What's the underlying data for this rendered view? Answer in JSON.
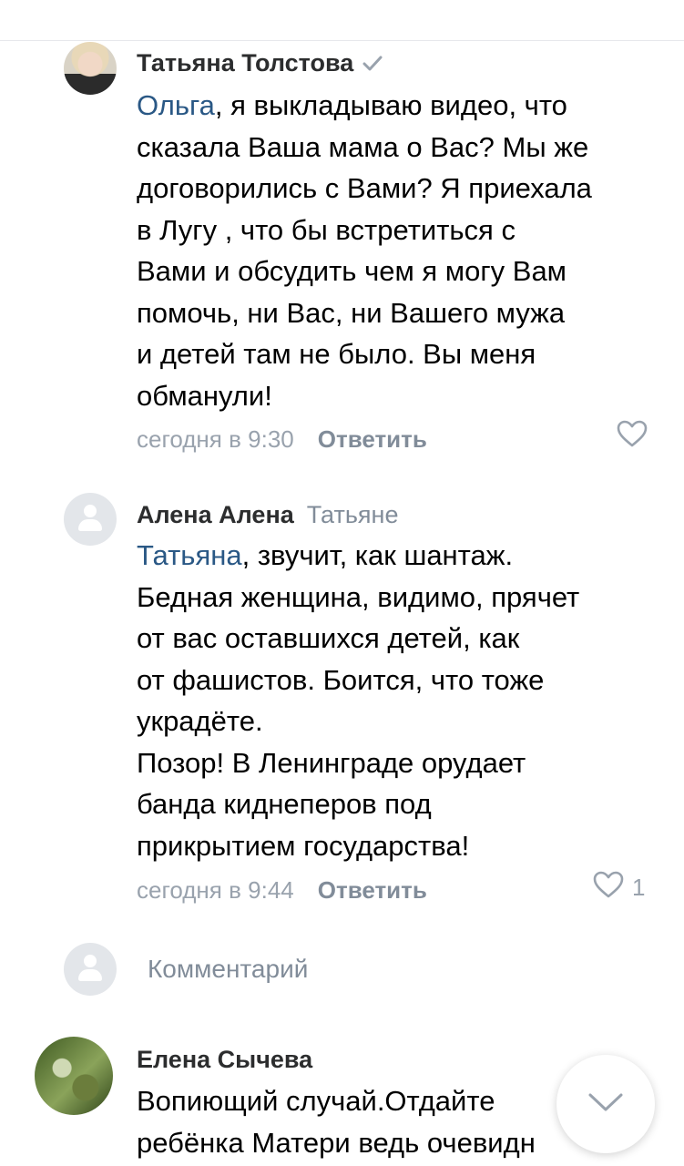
{
  "comments": [
    {
      "author": "Татьяна Толстова",
      "reply_to": "",
      "mention": "Ольга",
      "text": ", я выкладываю видео, что\nсказала Ваша мама о Вас? Мы же\nдоговорились с Вами? Я приехала\nв Лугу , что бы встретиться с\nВами и обсудить чем я могу Вам\nпомочь, ни Вас, ни Вашего мужа\nи детей там не было. Вы меня\nобманули!",
      "time": "сегодня в 9:30",
      "reply_label": "Ответить",
      "likes": ""
    },
    {
      "author": "Алена Алена",
      "reply_to": "Татьяне",
      "mention": "Татьяна",
      "text": ", звучит, как шантаж.\nБедная женщина, видимо, прячет\nот вас оставшихся детей, как\nот фашистов. Боится, что тоже\nукрадёте.\nПозор! В Ленинграде орудает\nбанда киднеперов под\nприкрытием государства!",
      "time": "сегодня в 9:44",
      "reply_label": "Ответить",
      "likes": "1"
    },
    {
      "author": "Елена Сычева",
      "text": "Вопиющий случай.Отдайте\nребёнка Матери ведь очевидн"
    }
  ],
  "compose": {
    "placeholder": "Комментарий"
  },
  "colors": {
    "link": "#2a5885",
    "secondary": "#818c99",
    "meta": "#99a2ad"
  },
  "icons": [
    "verified-icon",
    "heart-icon",
    "user-placeholder-icon",
    "chevron-down-icon"
  ]
}
